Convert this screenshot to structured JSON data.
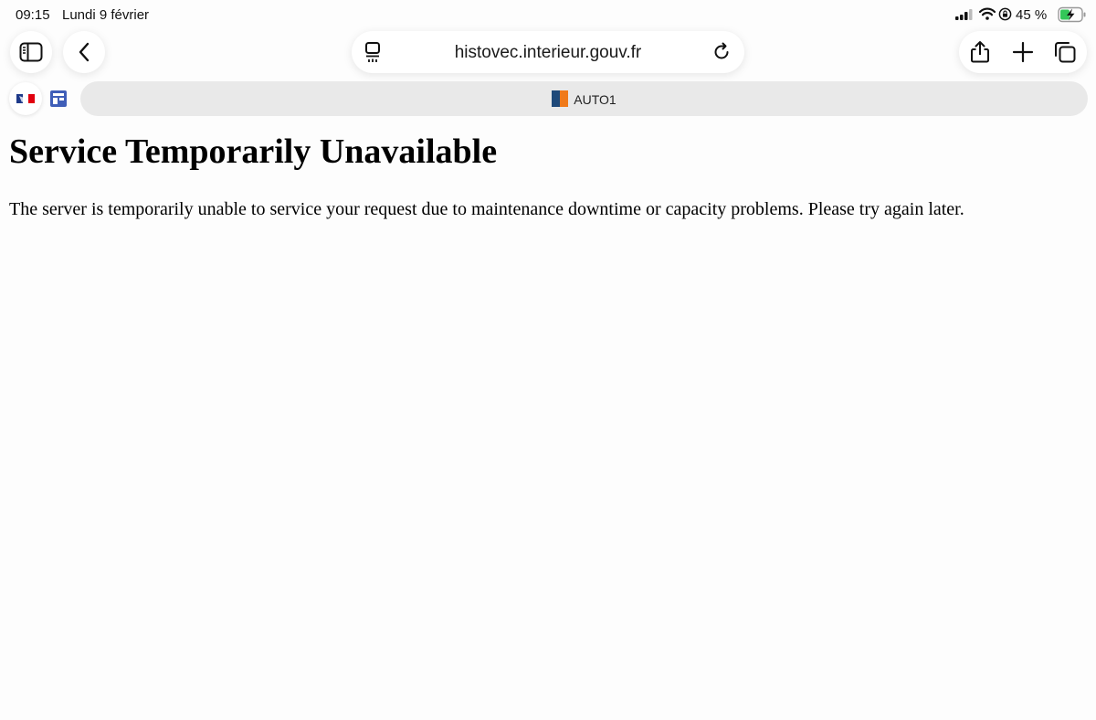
{
  "status_bar": {
    "time": "09:15",
    "date": "Lundi 9 février",
    "battery_percent": "45 %",
    "battery_level": 0.45
  },
  "toolbar": {
    "url": "histovec.interieur.gouv.fr",
    "icons": [
      "sidebar-icon",
      "back-chevron-icon",
      "reader-icon",
      "reload-icon",
      "share-icon",
      "plus-icon",
      "tabs-overview-icon"
    ]
  },
  "tabs": {
    "active_title": "AUTO1"
  },
  "page": {
    "heading": "Service Temporarily Unavailable",
    "message": "The server is temporarily unable to service your request due to maintenance downtime or capacity problems. Please try again later."
  },
  "colors": {
    "accent_blue": "#3f5eb8",
    "auto1_blue": "#1f4a7a",
    "auto1_orange": "#f07a1a",
    "battery_green": "#34c759"
  }
}
